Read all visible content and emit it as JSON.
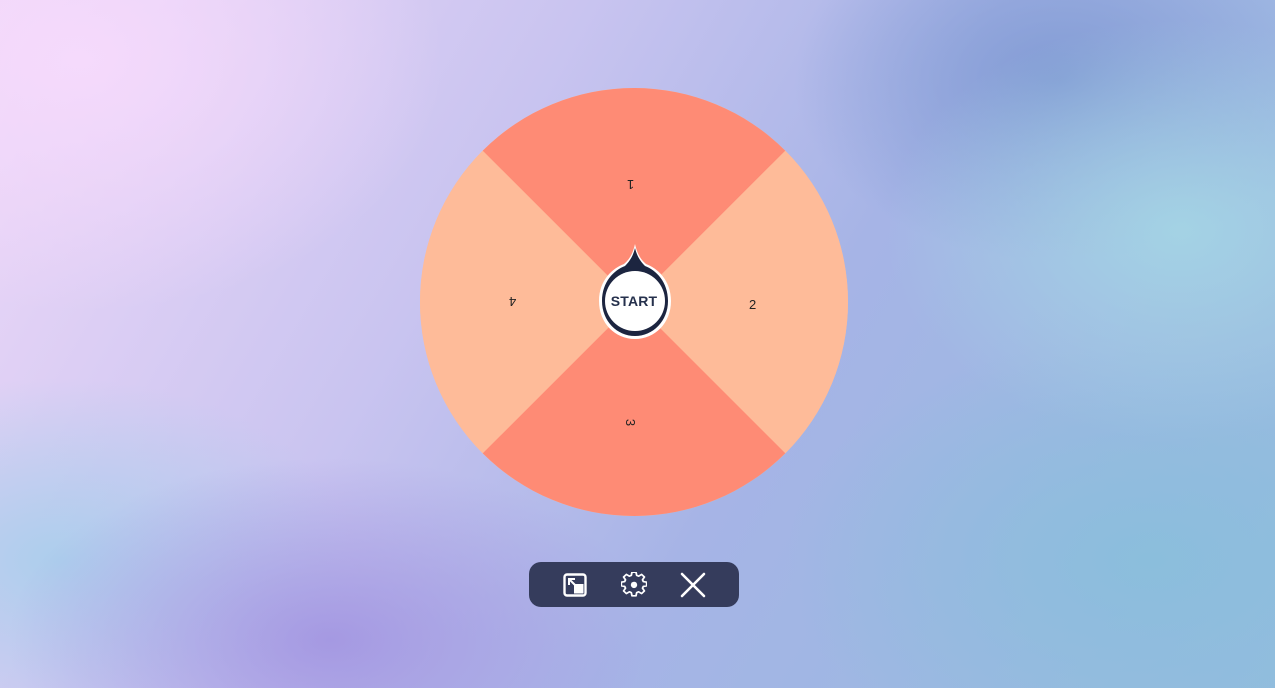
{
  "wheel": {
    "segments": [
      {
        "label": "1",
        "color": "#fe8b75"
      },
      {
        "label": "2",
        "color": "#febb99"
      },
      {
        "label": "3",
        "color": "#fe8b75"
      },
      {
        "label": "4",
        "color": "#febb99"
      }
    ],
    "start_label": "START",
    "center_ring_color": "#1c2540"
  },
  "toolbar": {
    "background": "#353c5c",
    "buttons": [
      {
        "icon": "picture-in-picture-icon"
      },
      {
        "icon": "gear-icon"
      },
      {
        "icon": "close-icon"
      }
    ]
  }
}
